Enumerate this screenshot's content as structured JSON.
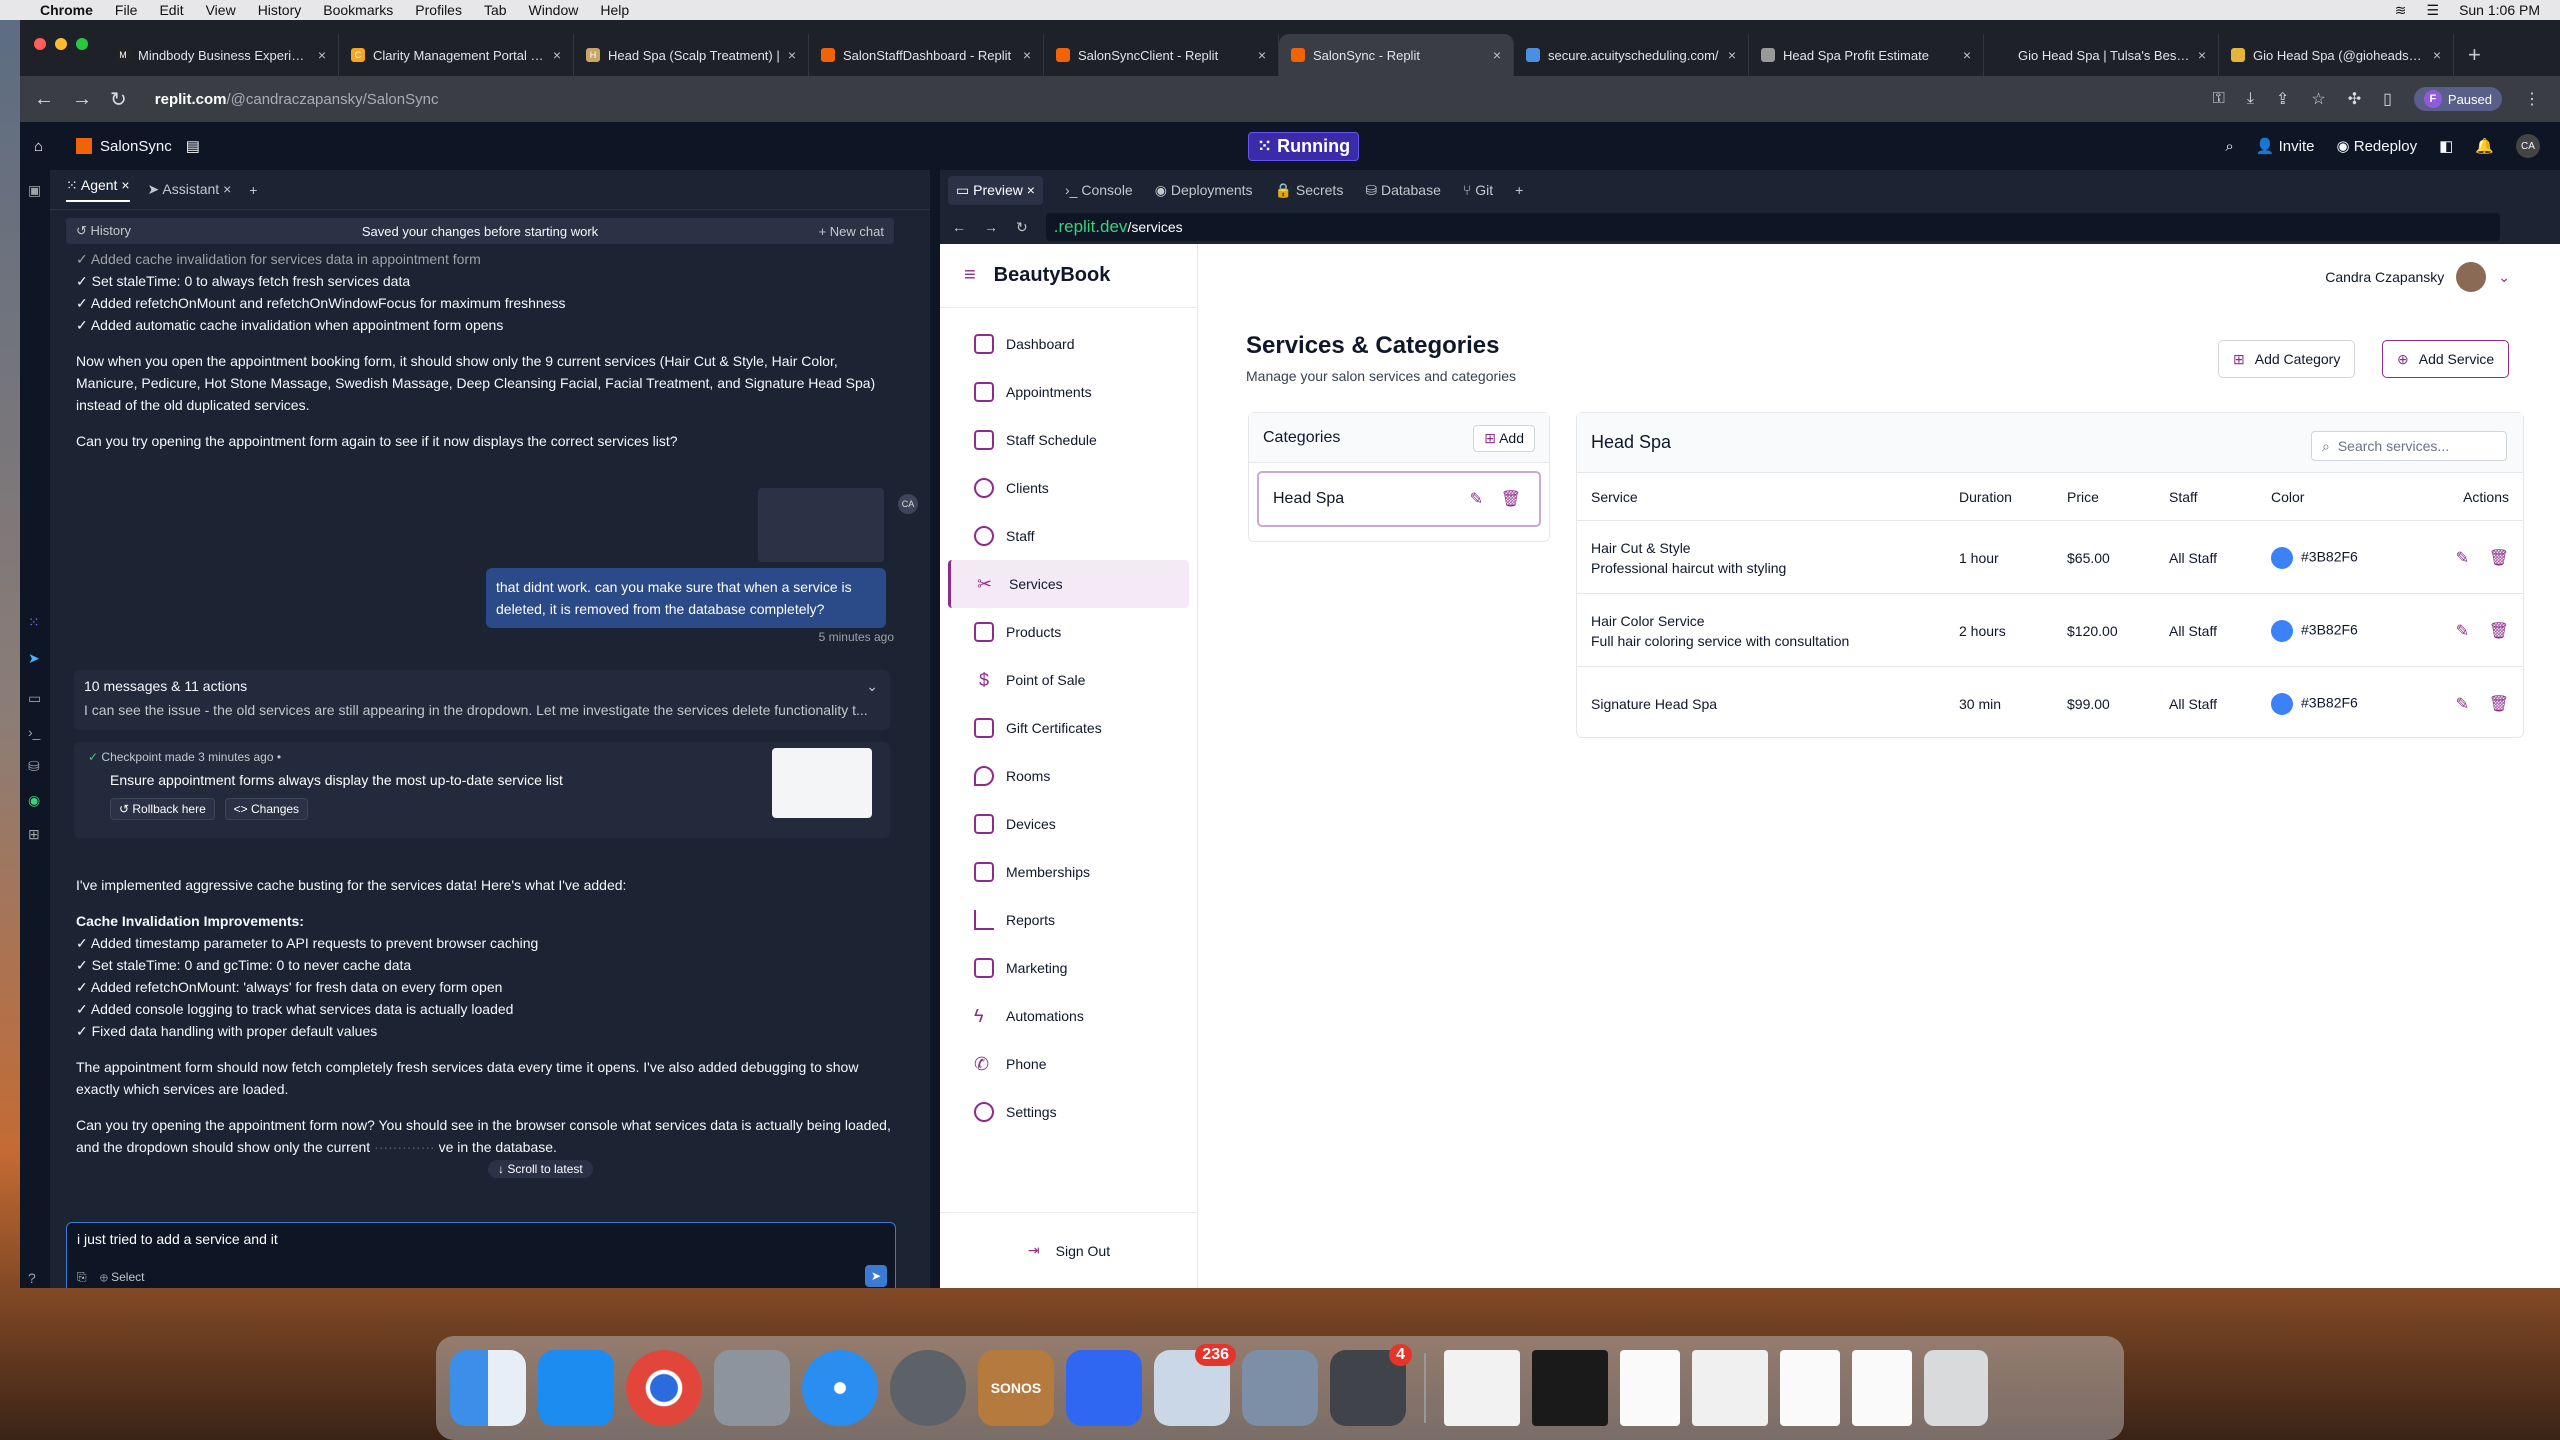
{
  "menubar": {
    "app": "Chrome",
    "items": [
      "File",
      "Edit",
      "View",
      "History",
      "Bookmarks",
      "Profiles",
      "Tab",
      "Window",
      "Help"
    ],
    "clock": "Sun 1:06 PM"
  },
  "browser_tabs": [
    {
      "title": "Mindbody Business Experience"
    },
    {
      "title": "Clarity Management Portal - C"
    },
    {
      "title": "Head Spa (Scalp Treatment) |"
    },
    {
      "title": "SalonStaffDashboard - Replit"
    },
    {
      "title": "SalonSyncClient - Replit"
    },
    {
      "title": "SalonSync - Replit"
    },
    {
      "title": "secure.acuityscheduling.com/"
    },
    {
      "title": "Head Spa Profit Estimate"
    },
    {
      "title": "Gio Head Spa | Tulsa's Best H"
    },
    {
      "title": "Gio Head Spa (@gioheadspa)"
    }
  ],
  "address": {
    "host": "replit.com",
    "path": "/@candraczapansky/SalonSync"
  },
  "profile": {
    "initial": "F",
    "status": "Paused"
  },
  "replit": {
    "project": "SalonSync",
    "status": "Running",
    "invite": "Invite",
    "redeploy": "Redeploy",
    "user_initials": "CA"
  },
  "left_panel": {
    "tabs": [
      "Agent",
      "Assistant"
    ],
    "history": "History",
    "saved": "Saved your changes before starting work",
    "new_chat": "New chat",
    "top_lines": [
      "✓ Added cache invalidation for services data in appointment form",
      "✓ Set staleTime: 0 to always fetch fresh services data",
      "✓ Added refetchOnMount and refetchOnWindowFocus for maximum freshness",
      "✓ Added automatic cache invalidation when appointment form opens"
    ],
    "para1": "Now when you open the appointment booking form, it should show only the 9 current services (Hair Cut & Style, Hair Color, Manicure, Pedicure, Hot Stone Massage, Swedish Massage, Deep Cleansing Facial, Facial Treatment, and Signature Head Spa) instead of the old duplicated services.",
    "para2": "Can you try opening the appointment form again to see if it now displays the correct services list?",
    "user_msg": "that didnt work. can you make sure that when a service is deleted, it is removed from the database completely?",
    "user_time": "5 minutes ago",
    "summary_title": "10 messages & 11 actions",
    "summary_text": "I can see the issue - the old services are still appearing in the dropdown. Let me investigate the services delete functionality t...",
    "checkpoint": "Checkpoint made 3 minutes ago •",
    "checkpoint_title": "Ensure appointment forms always display the most up-to-date service list",
    "rollback": "Rollback here",
    "changes": "Changes",
    "para3": "I've implemented aggressive cache busting for the services data! Here's what I've added:",
    "heading": "Cache Invalidation Improvements:",
    "list2": [
      "✓ Added timestamp parameter to API requests to prevent browser caching",
      "✓ Set staleTime: 0 and gcTime: 0 to never cache data",
      "✓ Added refetchOnMount: 'always' for fresh data on every form open",
      "✓ Added console logging to track what services data is actually loaded",
      "✓ Fixed data handling with proper default values"
    ],
    "para4": "The appointment form should now fetch completely fresh services data every time it opens. I've also added debugging to show exactly which services are loaded.",
    "para5": "Can you try opening the appointment form now? You should see in the browser console what services data is actually being loaded, and the dropdown should show only the current",
    "para5_end": "ve in the database.",
    "scroll_latest": "↓ Scroll to latest",
    "input_value": "i just tried to add a service and it",
    "select": "Select"
  },
  "right_panel": {
    "tabs": [
      "Preview",
      "Console",
      "Deployments",
      "Secrets",
      "Database",
      "Git"
    ],
    "url_domain": ".replit.dev",
    "url_path": "/services"
  },
  "beautybook": {
    "brand": "BeautyBook",
    "user": "Candra Czapansky",
    "nav": [
      "Dashboard",
      "Appointments",
      "Staff Schedule",
      "Clients",
      "Staff",
      "Services",
      "Products",
      "Point of Sale",
      "Gift Certificates",
      "Rooms",
      "Devices",
      "Memberships",
      "Reports",
      "Marketing",
      "Automations",
      "Phone",
      "Settings"
    ],
    "active_nav": "Services",
    "sign_out": "Sign Out",
    "title": "Services & Categories",
    "subtitle": "Manage your salon services and categories",
    "add_category": "Add Category",
    "add_service": "Add Service",
    "categories_title": "Categories",
    "add": "Add",
    "category": "Head Spa",
    "table_title": "Head Spa",
    "search_placeholder": "Search services...",
    "columns": [
      "Service",
      "Duration",
      "Price",
      "Staff",
      "Color",
      "Actions"
    ],
    "rows": [
      {
        "name": "Hair Cut & Style",
        "desc": "Professional haircut with styling",
        "duration": "1 hour",
        "price": "$65.00",
        "staff": "All Staff",
        "color": "#3B82F6"
      },
      {
        "name": "Hair Color Service",
        "desc": "Full hair coloring service with consultation",
        "duration": "2 hours",
        "price": "$120.00",
        "staff": "All Staff",
        "color": "#3B82F6"
      },
      {
        "name": "Signature Head Spa",
        "desc": "",
        "duration": "30 min",
        "price": "$99.00",
        "staff": "All Staff",
        "color": "#3B82F6"
      }
    ]
  },
  "dock": {
    "badges": [
      "236",
      "4"
    ],
    "sonos": "SONOS"
  }
}
